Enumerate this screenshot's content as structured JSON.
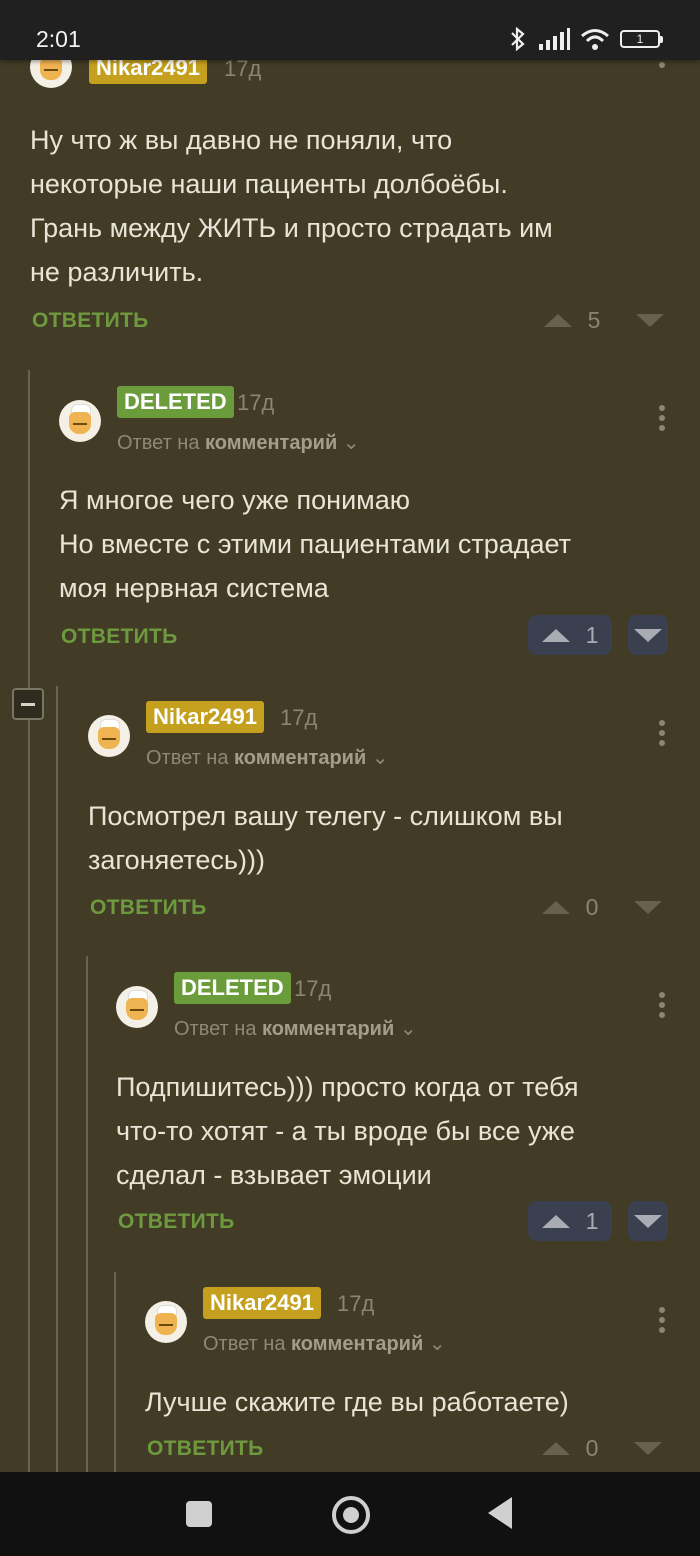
{
  "status_bar": {
    "time": "2:01",
    "battery": "1"
  },
  "reply_prefix": "Ответ на",
  "reply_link": "комментарий",
  "reply_action": "ОТВЕТИТЬ",
  "comments": [
    {
      "author": "Nikar2491",
      "time": "17д",
      "lines": [
        "Ну что ж вы давно не поняли, что",
        "некоторые наши пациенты долбоёбы.",
        "Грань между ЖИТЬ и просто страдать им",
        "не различить."
      ],
      "rating": "5"
    },
    {
      "author": "DELETED",
      "time": "17д",
      "lines": [
        "Я многое чего уже понимаю",
        "Но вместе с этими пациентами страдает",
        "моя нервная система"
      ],
      "rating": "1"
    },
    {
      "author": "Nikar2491",
      "time": "17д",
      "lines": [
        "Посмотрел вашу телегу - слишком вы",
        "загоняетесь)))"
      ],
      "rating": "0"
    },
    {
      "author": "DELETED",
      "time": "17д",
      "lines": [
        "Подпишитесь))) просто когда от тебя",
        "что-то хотят - а ты вроде бы все уже",
        "сделал - взывает эмоции"
      ],
      "rating": "1"
    },
    {
      "author": "Nikar2491",
      "time": "17д",
      "lines": [
        "Лучше скажите где вы работаете)"
      ],
      "rating": "0"
    }
  ],
  "colors": {
    "background": "#423b26",
    "author_badge": "#c4a01e",
    "deleted_badge": "#6a9c3c",
    "reply_action": "#6e9a3f"
  }
}
